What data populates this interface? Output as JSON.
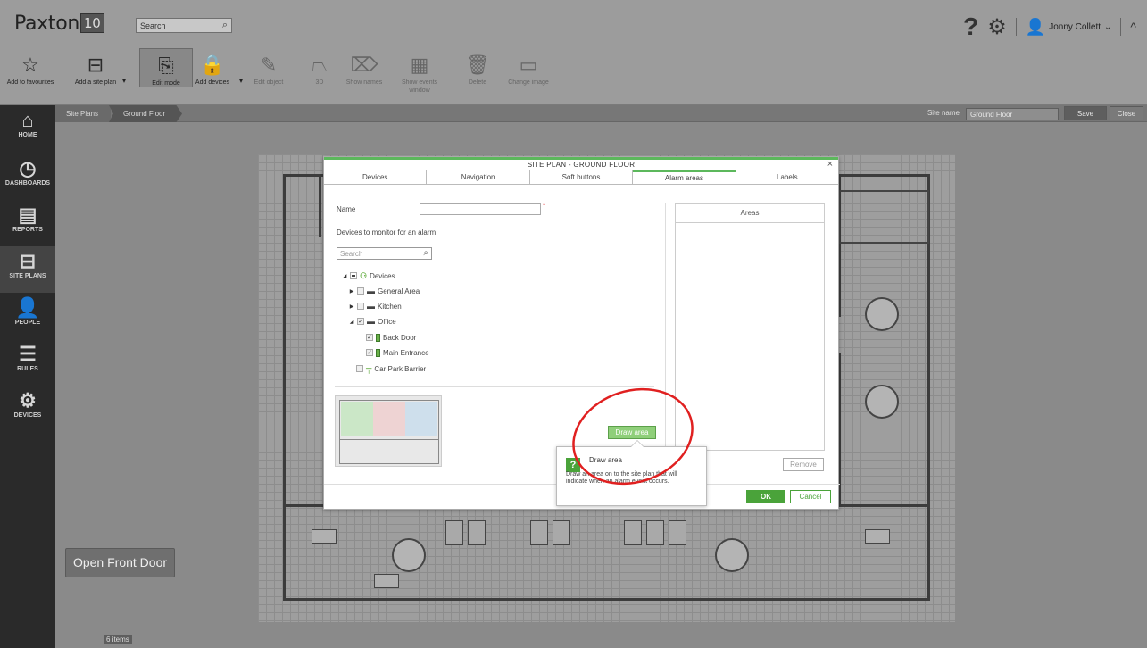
{
  "app": {
    "logo": "Paxton",
    "logo_badge": "10"
  },
  "header": {
    "search_placeholder": "Search",
    "help": "?",
    "user_name": "Jonny Collett"
  },
  "toolbar": {
    "items": [
      {
        "label": "Add to favourites"
      },
      {
        "label": "Add a site plan"
      },
      {
        "label": "Edit mode"
      },
      {
        "label": "Add devices"
      },
      {
        "label": "Edit object"
      },
      {
        "label": "3D"
      },
      {
        "label": "Show names"
      },
      {
        "label": "Show events window"
      },
      {
        "label": "Delete"
      },
      {
        "label": "Change image"
      }
    ]
  },
  "nav": {
    "items": [
      {
        "label": "HOME"
      },
      {
        "label": "DASHBOARDS"
      },
      {
        "label": "REPORTS"
      },
      {
        "label": "SITE PLANS"
      },
      {
        "label": "PEOPLE"
      },
      {
        "label": "RULES"
      },
      {
        "label": "DEVICES"
      }
    ]
  },
  "breadcrumb": {
    "root": "Site Plans",
    "current": "Ground Floor"
  },
  "site_bar": {
    "label": "Site name",
    "value": "Ground Floor",
    "save": "Save",
    "close": "Close"
  },
  "plan": {
    "button": "Open Front Door",
    "count": "6 items"
  },
  "modal": {
    "title": "SITE PLAN - GROUND FLOOR",
    "close": "×",
    "tabs": [
      "Devices",
      "Navigation",
      "Soft buttons",
      "Alarm areas",
      "Labels"
    ],
    "name_label": "Name",
    "required_mark": "*",
    "devices_label": "Devices to monitor for an alarm",
    "search_placeholder": "Search",
    "tree": {
      "root": "Devices",
      "general_area": "General Area",
      "kitchen": "Kitchen",
      "office": "Office",
      "back_door": "Back Door",
      "main_entrance": "Main Entrance",
      "car_park": "Car Park Barrier"
    },
    "draw_area": "Draw area",
    "areas_header": "Areas",
    "remove": "Remove",
    "ok": "OK",
    "cancel": "Cancel"
  },
  "tooltip": {
    "icon": "?",
    "title": "Draw area",
    "body": "Draw an area on to the site plan that will indicate when an alarm event occurs."
  },
  "colors": {
    "accent": "#5cb85c",
    "annotation": "#e02020",
    "nav_bg": "#2a2a2a"
  }
}
